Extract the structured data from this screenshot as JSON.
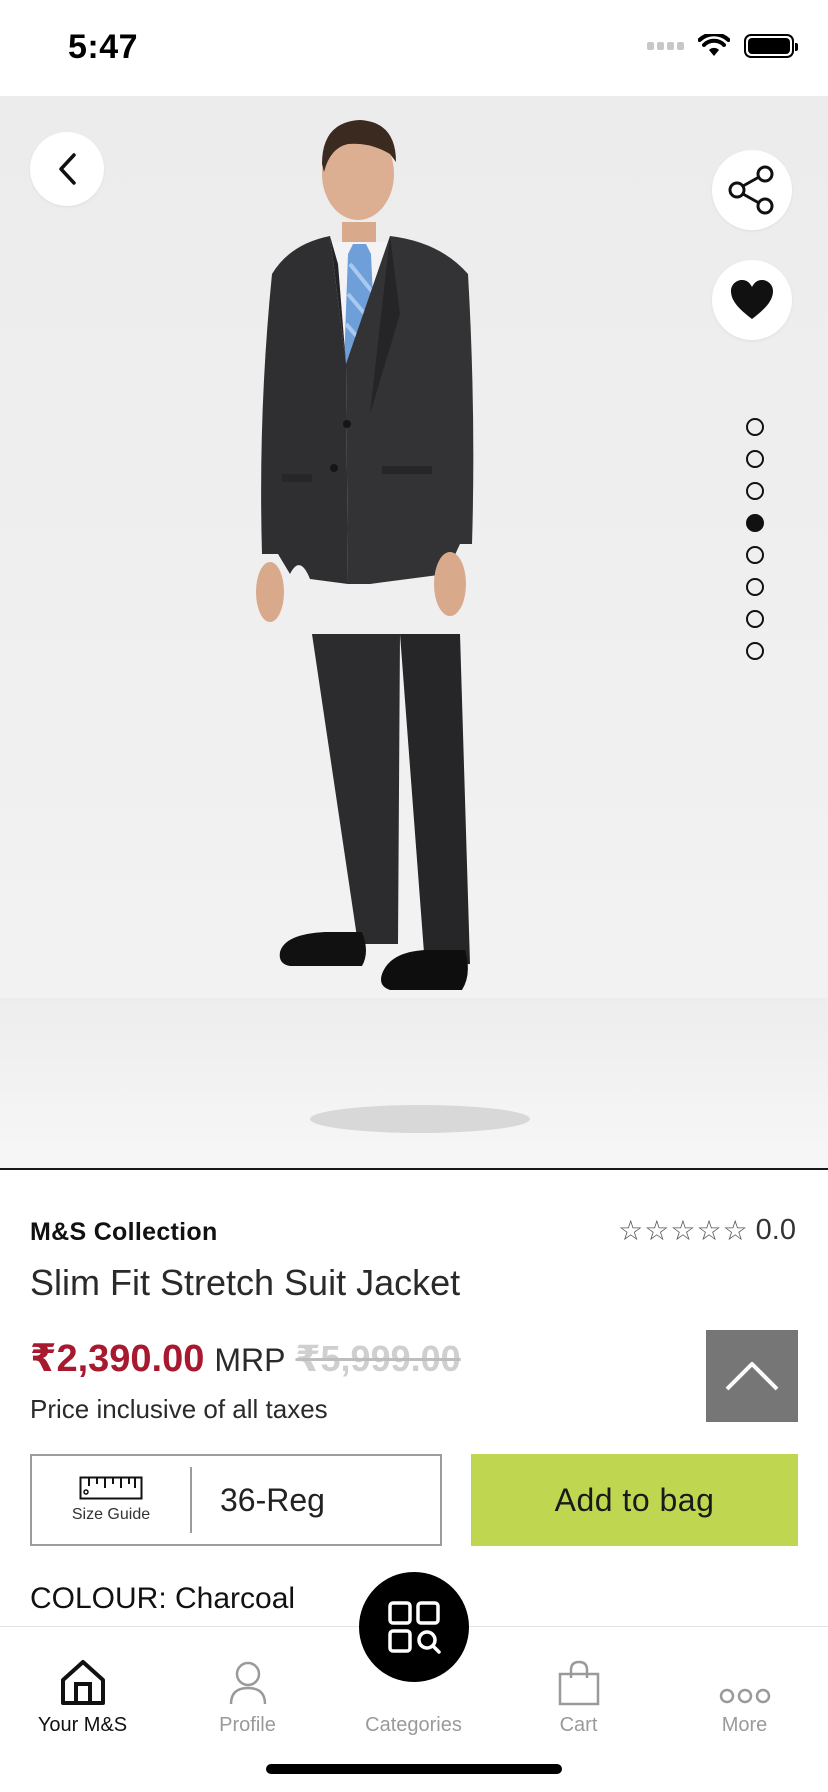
{
  "status": {
    "time": "5:47"
  },
  "product": {
    "brand": "M&S Collection",
    "title": "Slim Fit Stretch Suit Jacket",
    "rating": "0.0",
    "rating_stars": 0,
    "price": "₹2,390.00",
    "mrp_label": "MRP",
    "mrp": "₹5,999.00",
    "tax_note": "Price inclusive of all taxes",
    "size_guide_label": "Size Guide",
    "size": "36-Reg",
    "add_to_bag": "Add to bag",
    "colour": "COLOUR: Charcoal",
    "image_count": 8,
    "active_image": 4
  },
  "nav": {
    "items": [
      {
        "label": "Your M&S",
        "icon": "home-icon",
        "active": true
      },
      {
        "label": "Profile",
        "icon": "profile-icon",
        "active": false
      },
      {
        "label": "Categories",
        "icon": "categories-icon",
        "active": false
      },
      {
        "label": "Cart",
        "icon": "cart-icon",
        "active": false
      },
      {
        "label": "More",
        "icon": "more-icon",
        "active": false
      }
    ]
  },
  "colors": {
    "price": "#a6192e",
    "add_to_bag_bg": "#bfd650",
    "scroll_top_bg": "#767676"
  }
}
